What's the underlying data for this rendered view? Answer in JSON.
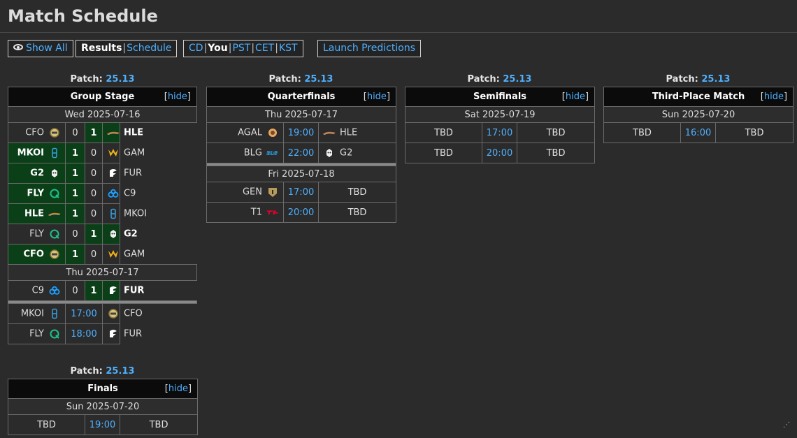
{
  "page": {
    "title": "Match Schedule"
  },
  "toolbar": {
    "show_all": "Show All",
    "results": "Results",
    "schedule": "Schedule",
    "tz_cd": "CD",
    "tz_you": "You",
    "tz_pst": "PST",
    "tz_cet": "CET",
    "tz_kst": "KST",
    "launch": "Launch Predictions",
    "separator": "|"
  },
  "labels": {
    "patch": "Patch:",
    "hide": "hide",
    "bracket_open": "[",
    "bracket_close": "]"
  },
  "colors": {
    "win_bg": "#0b3f18",
    "link": "#4eb0ff",
    "header_bg": "#0b0b0b"
  },
  "group_stage": {
    "patch": "25.13",
    "title": "Group Stage",
    "day1": "Wed 2025-07-16",
    "day2": "Thu 2025-07-17",
    "matches": [
      {
        "t1": "CFO",
        "i1": "cfo-logo-icon",
        "s1": "0",
        "s2": "1",
        "t2": "HLE",
        "i2": "hle-logo-icon",
        "winner": 2
      },
      {
        "t1": "MKOI",
        "i1": "mkoi-logo-icon",
        "s1": "1",
        "s2": "0",
        "t2": "GAM",
        "i2": "gam-logo-icon",
        "winner": 1
      },
      {
        "t1": "G2",
        "i1": "g2-logo-icon",
        "s1": "1",
        "s2": "0",
        "t2": "FUR",
        "i2": "fur-logo-icon",
        "winner": 1
      },
      {
        "t1": "FLY",
        "i1": "fly-logo-icon",
        "s1": "1",
        "s2": "0",
        "t2": "C9",
        "i2": "c9-logo-icon",
        "winner": 1
      },
      {
        "t1": "HLE",
        "i1": "hle-logo-icon",
        "s1": "1",
        "s2": "0",
        "t2": "MKOI",
        "i2": "mkoi-logo-icon",
        "winner": 1
      },
      {
        "t1": "FLY",
        "i1": "fly-logo-icon",
        "s1": "0",
        "s2": "1",
        "t2": "G2",
        "i2": "g2-logo-icon",
        "winner": 2
      },
      {
        "t1": "CFO",
        "i1": "cfo-logo-icon",
        "s1": "1",
        "s2": "0",
        "t2": "GAM",
        "i2": "gam-logo-icon",
        "winner": 1
      },
      {
        "t1": "C9",
        "i1": "c9-logo-icon",
        "s1": "0",
        "s2": "1",
        "t2": "FUR",
        "i2": "fur-logo-icon",
        "winner": 2
      }
    ],
    "upcoming": [
      {
        "t1": "MKOI",
        "time": "17:00",
        "t2": "CFO"
      },
      {
        "t1": "FLY",
        "time": "18:00",
        "t2": "FUR"
      }
    ]
  },
  "quarterfinals": {
    "patch": "25.13",
    "title": "Quarterfinals",
    "day1": "Thu 2025-07-17",
    "day2": "Fri 2025-07-18",
    "matches": [
      {
        "t1": "AGAL",
        "time": "19:00",
        "t2": "HLE"
      },
      {
        "t1": "BLG",
        "time": "22:00",
        "t2": "G2"
      },
      {
        "t1": "GEN",
        "time": "17:00",
        "t2": "TBD"
      },
      {
        "t1": "T1",
        "time": "20:00",
        "t2": "TBD"
      }
    ]
  },
  "semifinals": {
    "patch": "25.13",
    "title": "Semifinals",
    "day1": "Sat 2025-07-19",
    "matches": [
      {
        "t1": "TBD",
        "time": "17:00",
        "t2": "TBD"
      },
      {
        "t1": "TBD",
        "time": "20:00",
        "t2": "TBD"
      }
    ]
  },
  "third_place": {
    "patch": "25.13",
    "title": "Third-Place Match",
    "day1": "Sun 2025-07-20",
    "matches": [
      {
        "t1": "TBD",
        "time": "16:00",
        "t2": "TBD"
      }
    ]
  },
  "finals": {
    "patch": "25.13",
    "title": "Finals",
    "day1": "Sun 2025-07-20",
    "matches": [
      {
        "t1": "TBD",
        "time": "19:00",
        "t2": "TBD"
      }
    ]
  }
}
